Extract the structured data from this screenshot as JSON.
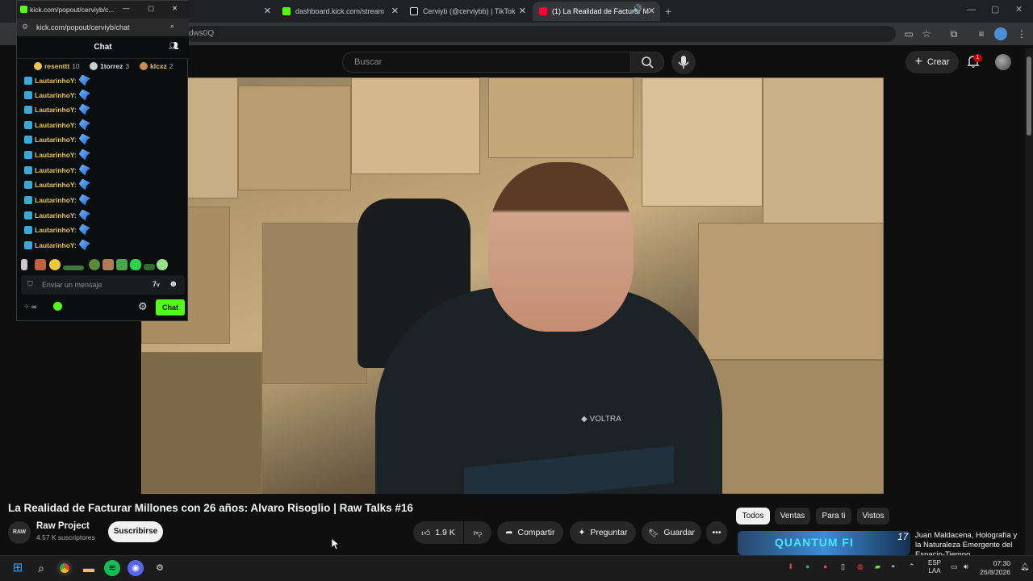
{
  "browser": {
    "tabs": [
      {
        "label": "kick.com/popout/cerviyb/c...",
        "active": false
      },
      {
        "label": "dashboard.kick.com/stream",
        "active": false
      },
      {
        "label": "Cerviyb (@cerviybb) | TikTok",
        "active": false
      },
      {
        "label": "(1) La Realidad de Facturar M",
        "active": true
      }
    ],
    "url_fragment": "dws0Q"
  },
  "popout": {
    "window_title": "kick.com/popout/cerviyb/c...",
    "url": "kick.com/popout/cerviyb/chat",
    "chat_title": "Chat",
    "leaders": [
      {
        "name": "resenttt",
        "count": "10",
        "medal_color": "#e8c456"
      },
      {
        "name": "1torrez",
        "count": "3",
        "medal_color": "#cfcfcf"
      },
      {
        "name": "klcxz",
        "count": "2",
        "medal_color": "#c98a4b"
      }
    ],
    "messages": [
      {
        "user": "LautarinhoY:"
      },
      {
        "user": "LautarinhoY:"
      },
      {
        "user": "LautarinhoY:"
      },
      {
        "user": "LautarinhoY:"
      },
      {
        "user": "LautarinhoY:"
      },
      {
        "user": "LautarinhoY:"
      },
      {
        "user": "LautarinhoY:"
      },
      {
        "user": "LautarinhoY:"
      },
      {
        "user": "LautarinhoY:"
      },
      {
        "user": "LautarinhoY:"
      },
      {
        "user": "LautarinhoY:"
      },
      {
        "user": "LautarinhoY:"
      }
    ],
    "input_placeholder": "Enviar un mensaje",
    "chat_button": "Chat",
    "kick_green": "#53fc18"
  },
  "youtube": {
    "search_placeholder": "Buscar",
    "create_label": "Crear",
    "notification_count": "1",
    "video_title": "La Realidad de Facturar Millones con 26 años: Alvaro Risoglio | Raw Talks #16",
    "video_shirt_text": "VOLTRA",
    "channel_avatar_text": "RAW",
    "channel_name": "Raw Project",
    "subscribers": "4.57 K suscriptores",
    "subscribe_label": "Suscribirse",
    "likes": "1.9 K",
    "share_label": "Compartir",
    "ask_label": "Preguntar",
    "save_label": "Guardar",
    "chips": [
      "Todos",
      "Ventas",
      "Para ti",
      "Vistos"
    ],
    "suggestion": {
      "thumb_text": "QUANTUM FI",
      "thumb_number": "17",
      "title": "Juan Maldacena, Holografía y la Naturaleza Emergente del Espacio-Tiempo"
    }
  },
  "taskbar": {
    "lang_top": "ESP",
    "lang_bottom": "LAA",
    "time": "07:30",
    "date": "26/8/2026"
  }
}
